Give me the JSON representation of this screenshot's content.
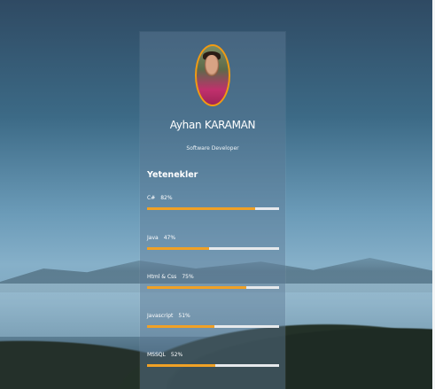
{
  "profile": {
    "name": "Ayhan KARAMAN",
    "role": "Software Developer"
  },
  "skills_section": {
    "heading": "Yetenekler",
    "items": [
      {
        "label": "C#",
        "percent_text": "82%",
        "level": 0.82
      },
      {
        "label": "Java",
        "percent_text": "47%",
        "level": 0.47
      },
      {
        "label": "Html & Css",
        "percent_text": "75%",
        "level": 0.75
      },
      {
        "label": "Javascript",
        "percent_text": "51%",
        "level": 0.51
      },
      {
        "label": "MSSQL",
        "percent_text": "52%",
        "level": 0.52
      }
    ]
  },
  "colors": {
    "accent": "#f0a126",
    "track": "#e6e9ec",
    "avatar_ring": "#f29b12"
  }
}
